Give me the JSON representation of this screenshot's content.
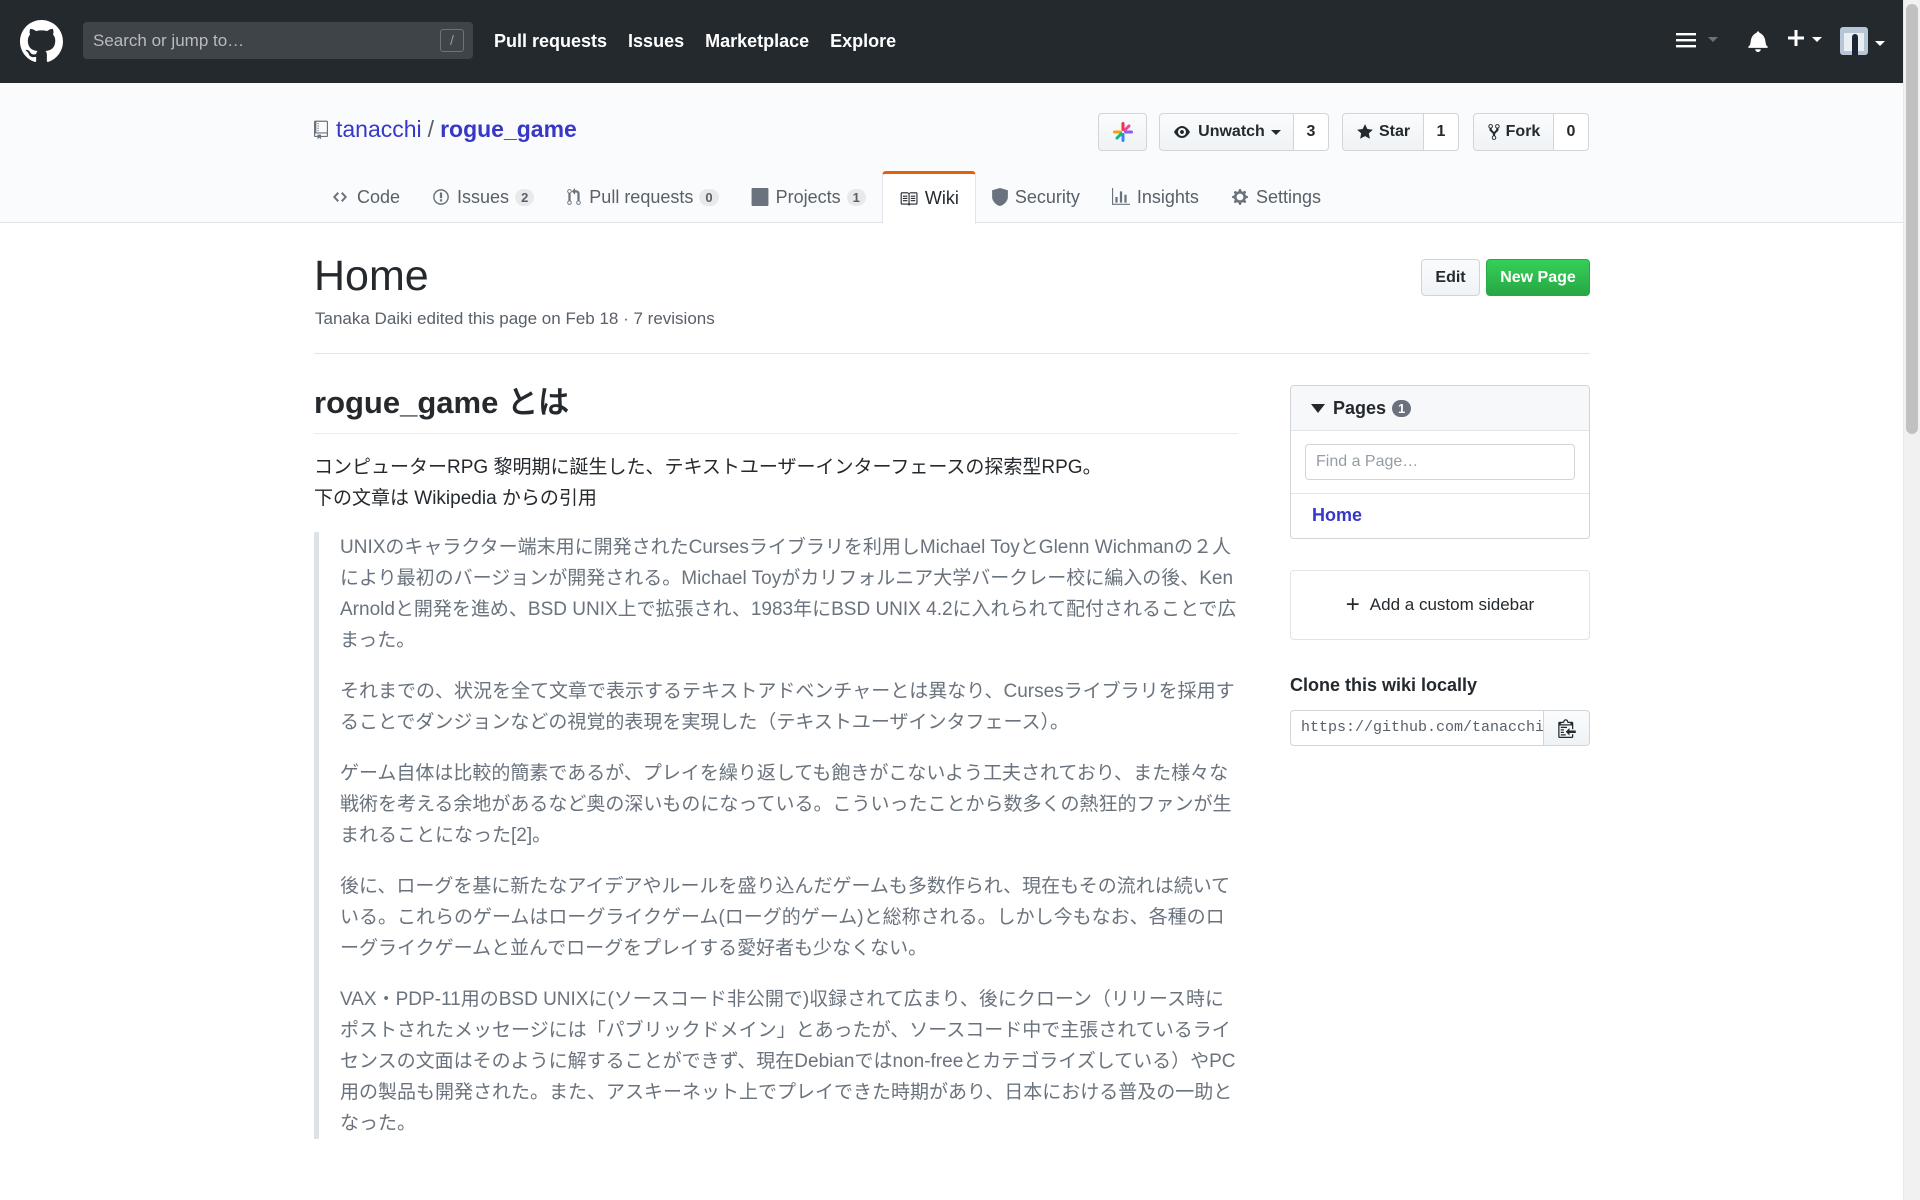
{
  "header": {
    "search_placeholder": "Search or jump to…",
    "search_key": "/",
    "nav": [
      "Pull requests",
      "Issues",
      "Marketplace",
      "Explore"
    ]
  },
  "repo": {
    "owner": "tanacchi",
    "separator": "/",
    "name": "rogue_game",
    "watch_label": "Unwatch",
    "watch_count": "3",
    "star_label": "Star",
    "star_count": "1",
    "fork_label": "Fork",
    "fork_count": "0",
    "tabs": [
      {
        "label": "Code",
        "count": ""
      },
      {
        "label": "Issues",
        "count": "2"
      },
      {
        "label": "Pull requests",
        "count": "0"
      },
      {
        "label": "Projects",
        "count": "1"
      },
      {
        "label": "Wiki",
        "count": ""
      },
      {
        "label": "Security",
        "count": ""
      },
      {
        "label": "Insights",
        "count": ""
      },
      {
        "label": "Settings",
        "count": ""
      }
    ]
  },
  "wiki": {
    "title": "Home",
    "meta": "Tanaka Daiki edited this page on Feb 18 · 7 revisions",
    "edit_label": "Edit",
    "new_page_label": "New Page",
    "heading": "rogue_game とは",
    "lead_1": "コンピューターRPG 黎明期に誕生した、テキストユーザーインターフェースの探索型RPG。",
    "lead_2": "下の文章は Wikipedia からの引用",
    "quote": [
      "UNIXのキャラクター端末用に開発されたCursesライブラリを利用しMichael ToyとGlenn Wichmanの２人により最初のバージョンが開発される。Michael Toyがカリフォルニア大学バークレー校に編入の後、Ken Arnoldと開発を進め、BSD UNIX上で拡張され、1983年にBSD UNIX 4.2に入れられて配付されることで広まった。",
      "それまでの、状況を全て文章で表示するテキストアドベンチャーとは異なり、Cursesライブラリを採用することでダンジョンなどの視覚的表現を実現した（テキストユーザインタフェース）。",
      "ゲーム自体は比較的簡素であるが、プレイを繰り返しても飽きがこないよう工夫されており、また様々な戦術を考える余地があるなど奥の深いものになっている。こういったことから数多くの熱狂的ファンが生まれることになった[2]。",
      "後に、ローグを基に新たなアイデアやルールを盛り込んだゲームも多数作られ、現在もその流れは続いている。これらのゲームはローグライクゲーム(ローグ的ゲーム)と総称される。しかし今もなお、各種のローグライクゲームと並んでローグをプレイする愛好者も少なくない。",
      "VAX・PDP-11用のBSD UNIXに(ソースコード非公開で)収録されて広まり、後にクローン（リリース時にポストされたメッセージには「パブリックドメイン」とあったが、ソースコード中で主張されているライセンスの文面はそのように解することができず、現在Debianではnon-freeとカテゴライズしている）やPC用の製品も開発された。また、アスキーネット上でプレイできた時期があり、日本における普及の一助となった。"
    ]
  },
  "sidebar": {
    "pages_label": "Pages",
    "pages_count": "1",
    "filter_placeholder": "Find a Page…",
    "pages": [
      "Home"
    ],
    "custom_sidebar_label": "Add a custom sidebar",
    "clone_title": "Clone this wiki locally",
    "clone_url": "https://github.com/tanacchi/rogue_game.wiki.git"
  },
  "colors": {
    "header_bg": "#24292e",
    "link": "#3737c8",
    "tab_accent": "#e36209",
    "primary_button": "#28a745"
  }
}
